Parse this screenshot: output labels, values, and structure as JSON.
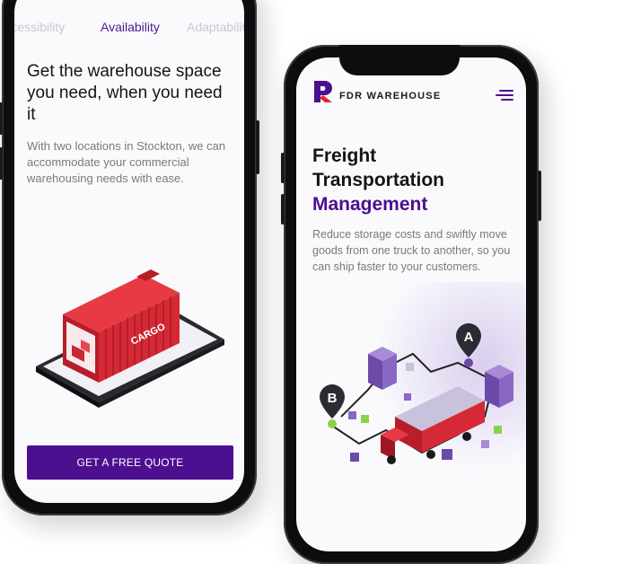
{
  "phone_left": {
    "tabs": [
      {
        "label": "Accessibility",
        "active": false
      },
      {
        "label": "Availability",
        "active": true
      },
      {
        "label": "Adaptability",
        "active": false
      }
    ],
    "heading": "Get the warehouse space you need, when you need it",
    "body": "With two locations in Stockton, we can accommodate your commercial warehousing needs with ease.",
    "cta_label": "GET A FREE QUOTE",
    "illustration_text": "CARGO"
  },
  "phone_right": {
    "brand": "FDR WAREHOUSE",
    "heading_line1": "Freight",
    "heading_line2": "Transportation",
    "heading_accent": "Management",
    "body": "Reduce storage costs and swiftly move goods from one truck to another, so you can ship faster to your customers.",
    "pin_a": "A",
    "pin_b": "B",
    "menu_icon": "hamburger-menu-icon"
  },
  "colors": {
    "accent": "#4b0f8f",
    "logo_red": "#e0262f",
    "body_text": "#7a7a7a",
    "heading_text": "#151515"
  }
}
